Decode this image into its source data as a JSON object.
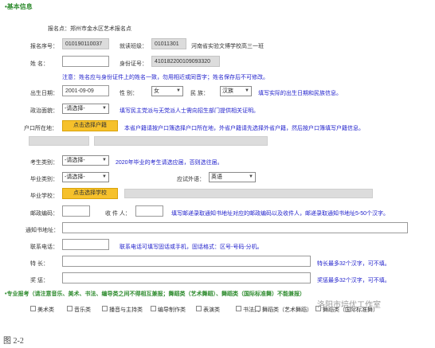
{
  "section_basic": "•基本信息",
  "venue": "报名点：郑州市金水区艺术报名点",
  "reg_no": {
    "label": "报名序号：",
    "value": "010190110037"
  },
  "class": {
    "label": "就读班级：",
    "value": "01011301",
    "text": "河南省实验文博学校高三一班"
  },
  "name": {
    "label": "姓      名："
  },
  "idcard": {
    "label": "身份证号：",
    "value": "410182200109093320"
  },
  "note_name": "注意：姓名应与身份证件上的姓名一致，勿用相近或同音字；姓名保存后不可修改。",
  "birth": {
    "label": "出生日期：",
    "value": "2001-09-09"
  },
  "gender": {
    "label": "性   别：",
    "value": "女"
  },
  "ethnic": {
    "label": "民   族：",
    "value": "汉族"
  },
  "note_birth": "填写实际的出生日期和民族信息。",
  "politics": {
    "label": "政治面貌：",
    "value": "-请选择-"
  },
  "note_politics": "填写民主党派与无党派人士需向招生部门提供相关证明。",
  "hukou": {
    "label": "户口所在地：",
    "button": "点击选择户籍"
  },
  "note_hukou": "本省户籍请按户口簿选择户口所在地，外省户籍请先选择外省户籍，然后按户口簿填写户籍信息。",
  "exam_type": {
    "label": "考生类别：",
    "value": "-请选择-"
  },
  "note_exam": "2020年毕业的考生请选应届，否则选往届。",
  "grad_type": {
    "label": "毕业类别：",
    "value": "-请选择-"
  },
  "lang": {
    "label": "应试外语：",
    "value": "英语"
  },
  "school": {
    "label": "毕业学校：",
    "button": "点击选择学校"
  },
  "postcode": {
    "label": "邮政编码："
  },
  "recipient": {
    "label": "收 件 人："
  },
  "note_post": "填写邮递录取通知书地址对应的邮政编码以及收件人，邮递录取通知书地址5-50个汉字。",
  "address": {
    "label": "通知书地址："
  },
  "phone": {
    "label": "联系电话："
  },
  "note_phone": "联系电话可填写固话或手机，固话格式：区号-号码-分机。",
  "specialty": {
    "label": "特    长：",
    "note": "特长最多32个汉字，可不填。"
  },
  "awards": {
    "label": "奖    惩：",
    "note": "奖惩最多32个汉字，可不填。"
  },
  "section_major": "•专业报考（请注意音乐、美术、书法、编导类之间不得相互兼报；舞蹈类（艺术舞蹈）、舞蹈类（国际标准舞）不能兼报）",
  "majors": [
    "美术类",
    "音乐类",
    "播音与主持类",
    "编导制作类",
    "表演类",
    "书法类",
    "舞蹈类（艺术舞蹈）",
    "舞蹈类（国际标准舞）"
  ],
  "watermark": "洛阳市培优工作室",
  "caption": "图 2-2",
  "colors": {
    "section": "#2e8b2e",
    "note": "#2222cc",
    "button": "#f6c12b"
  },
  "icons": [
    "chevron-down-icon",
    "checkbox-icon"
  ]
}
